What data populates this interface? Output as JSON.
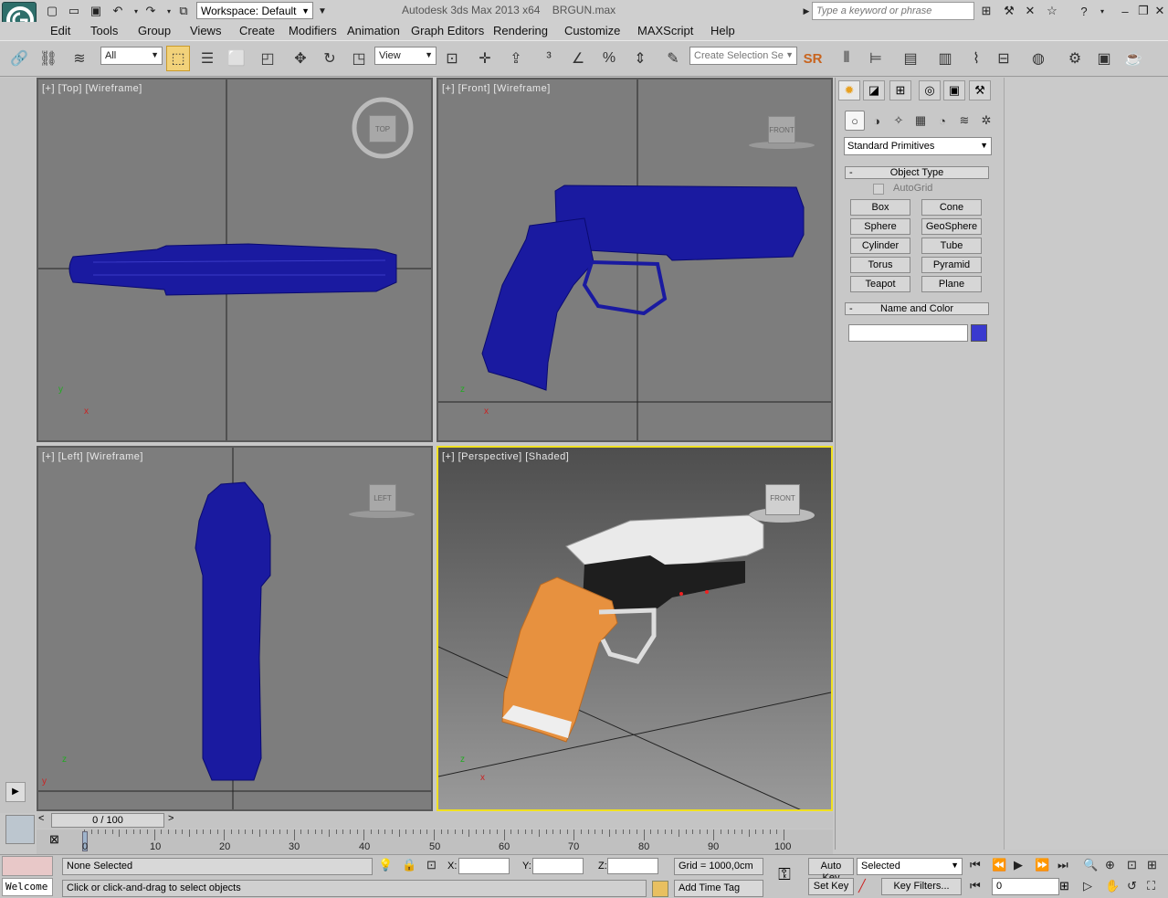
{
  "titlebar": {
    "workspace": "Workspace: Default",
    "app_title": "Autodesk 3ds Max  2013 x64",
    "file_name": "BRGUN.max",
    "search_placeholder": "Type a keyword or phrase"
  },
  "menu": [
    "Edit",
    "Tools",
    "Group",
    "Views",
    "Create",
    "Modifiers",
    "Animation",
    "Graph Editors",
    "Rendering",
    "Customize",
    "MAXScript",
    "Help"
  ],
  "toolbar": {
    "filter": "All",
    "ref_coord": "View",
    "selection_set": "Create Selection Se",
    "sr_label": "SR"
  },
  "viewports": {
    "top_left": "[+] [Top] [Wireframe]",
    "top_right": "[+] [Front] [Wireframe]",
    "bottom_left": "[+] [Left] [Wireframe]",
    "bottom_right": "[+] [Perspective] [Shaded]",
    "cube_top": "TOP",
    "cube_front": "FRONT",
    "cube_left": "LEFT",
    "axis_x": "x",
    "axis_y": "y",
    "axis_z": "z"
  },
  "command_panel": {
    "primitive_type": "Standard Primitives",
    "object_type_title": "Object Type",
    "autogrid": "AutoGrid",
    "buttons": [
      "Box",
      "Cone",
      "Sphere",
      "GeoSphere",
      "Cylinder",
      "Tube",
      "Torus",
      "Pyramid",
      "Teapot",
      "Plane"
    ],
    "name_color_title": "Name and Color",
    "rollout_minus": "-",
    "object_color": "#3a3acf"
  },
  "timeline": {
    "slider": "0 / 100",
    "prev": "<",
    "next": ">",
    "ticks": [
      "0",
      "10",
      "20",
      "30",
      "40",
      "50",
      "60",
      "70",
      "80",
      "90",
      "100"
    ]
  },
  "status": {
    "welcome": "Welcome",
    "selection": "None Selected",
    "prompt": "Click or click-and-drag to select objects",
    "x_label": "X:",
    "y_label": "Y:",
    "z_label": "Z:",
    "grid": "Grid = 1000,0cm",
    "add_time_tag": "Add Time Tag",
    "auto_key": "Auto Key",
    "set_key": "Set Key",
    "key_mode": "Selected",
    "key_filters": "Key Filters...",
    "frame": "0"
  }
}
